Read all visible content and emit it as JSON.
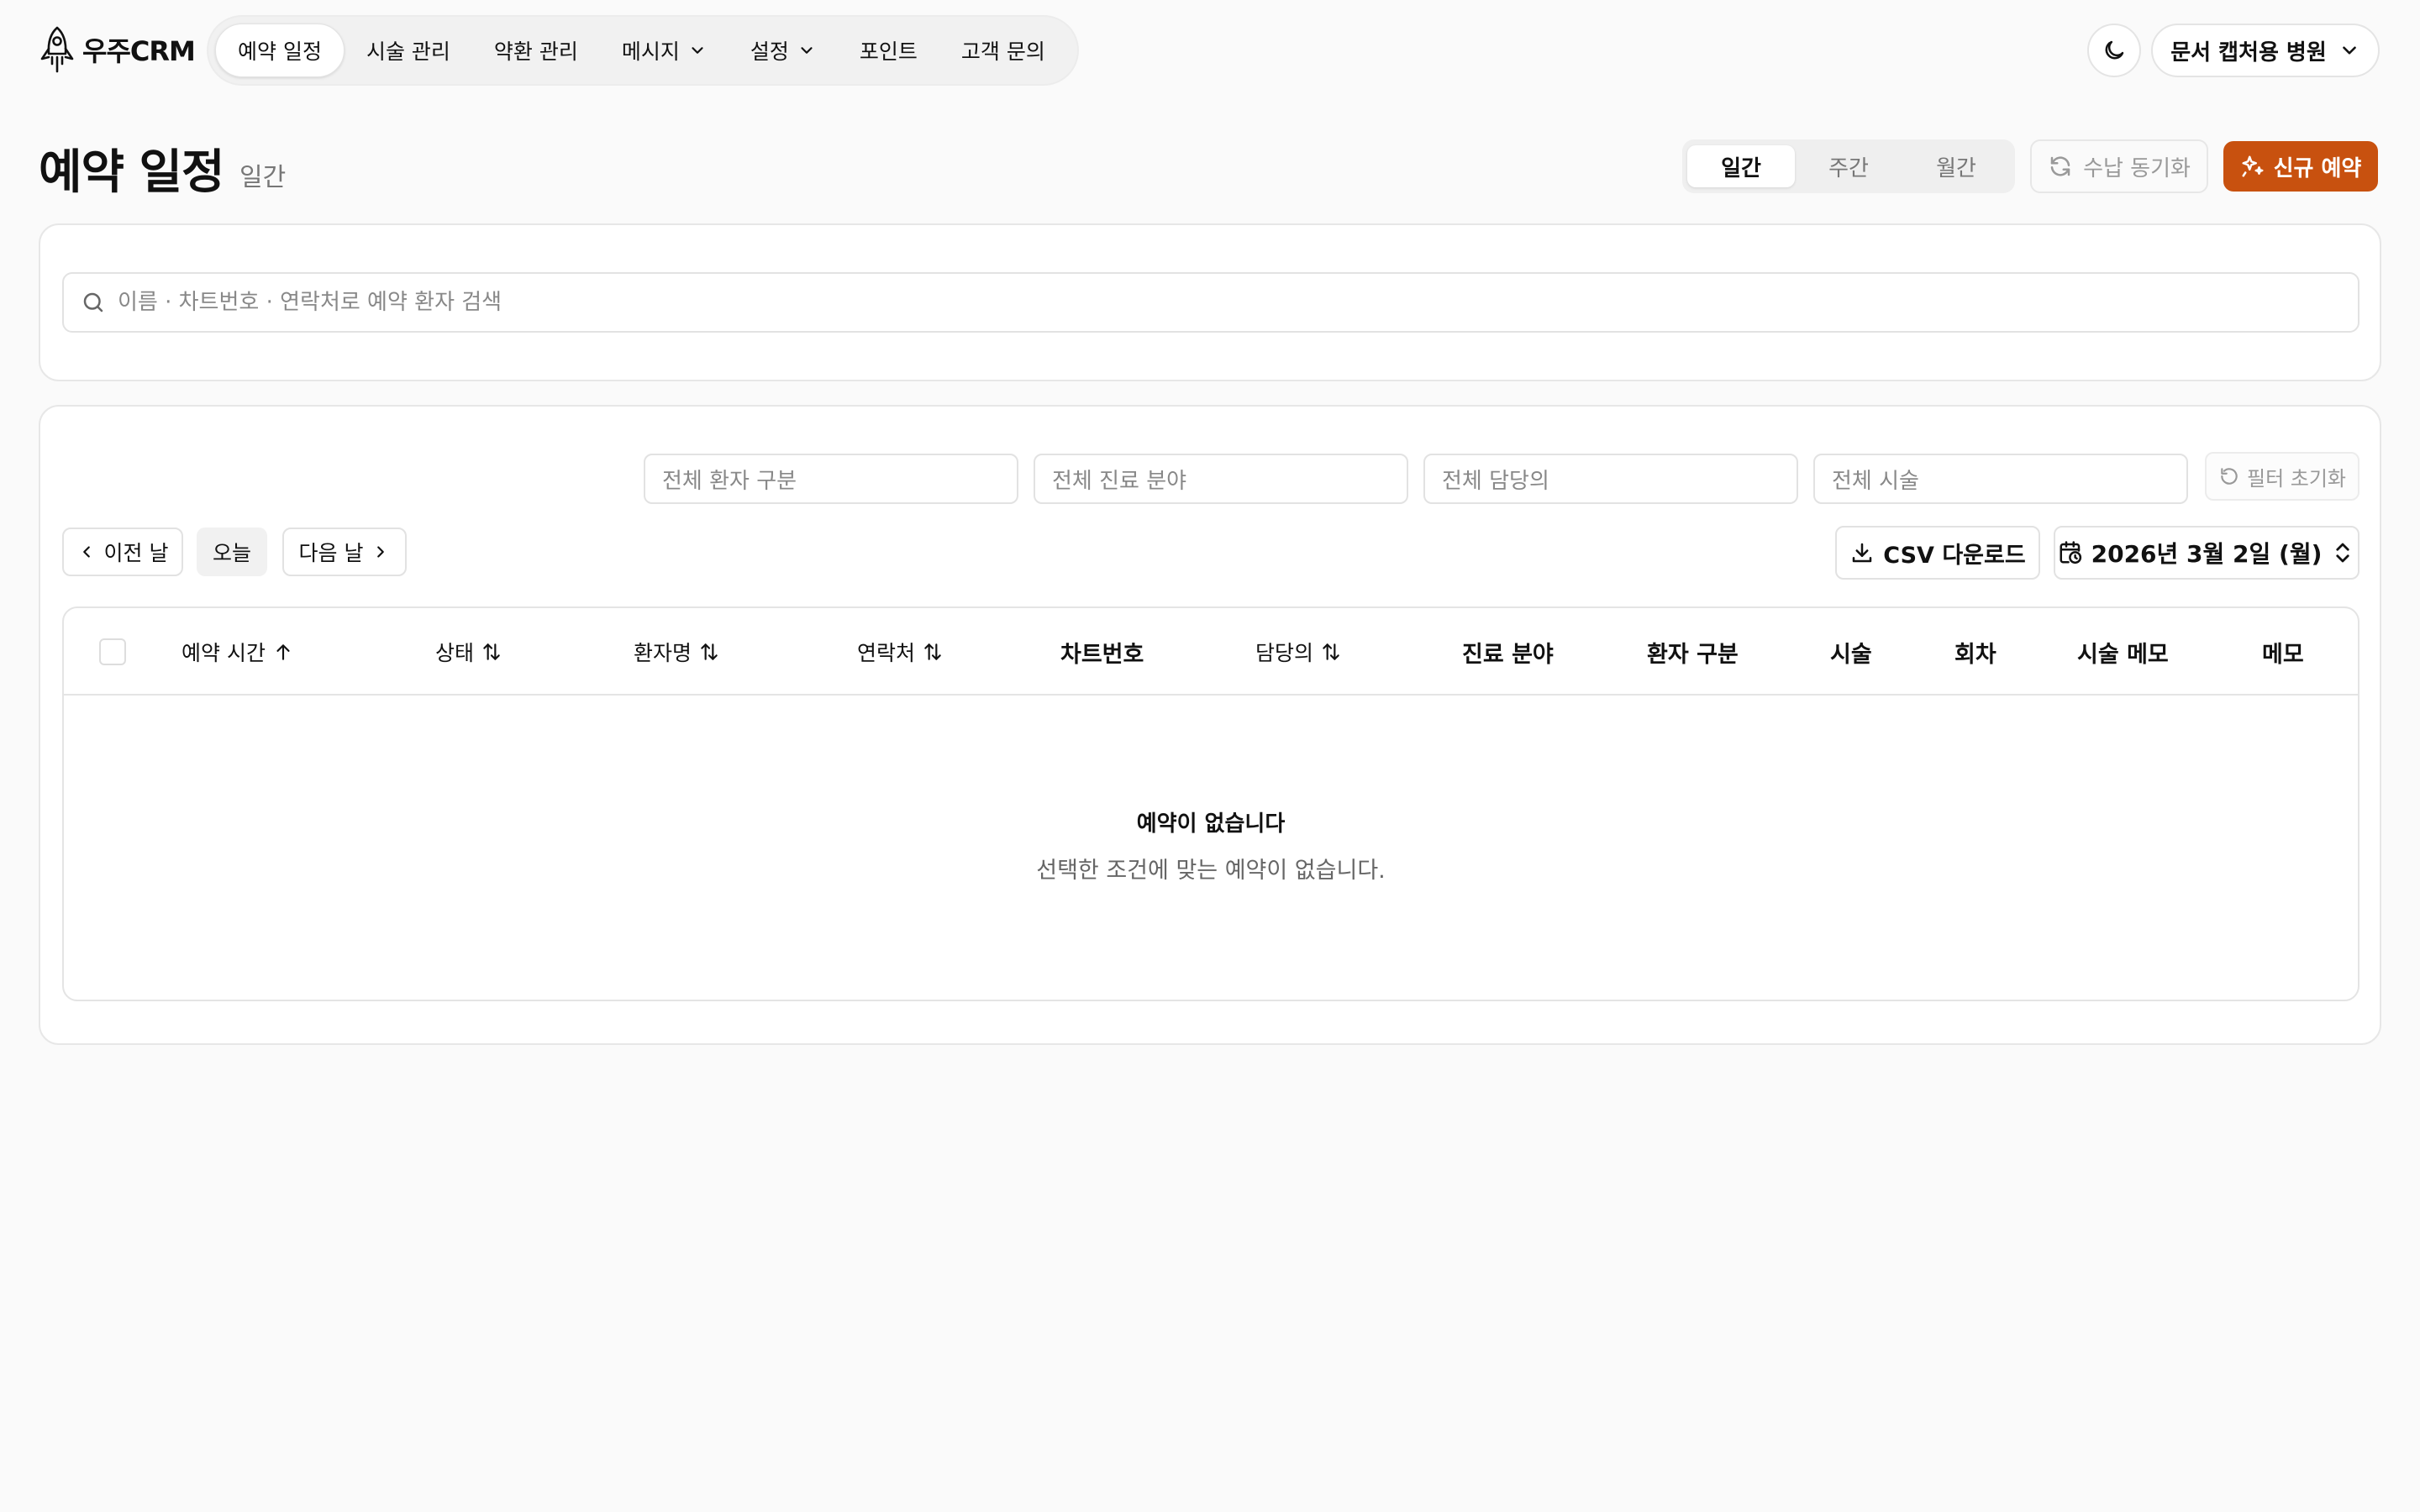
{
  "app": {
    "logo_text": "우주CRM"
  },
  "nav": {
    "items": [
      {
        "label": "예약 일정"
      },
      {
        "label": "시술 관리"
      },
      {
        "label": "약환 관리"
      },
      {
        "label": "메시지"
      },
      {
        "label": "설정"
      },
      {
        "label": "포인트"
      },
      {
        "label": "고객 문의"
      }
    ]
  },
  "header": {
    "clinic_label": "문서 캡처용 병원"
  },
  "page": {
    "title": "예약 일정",
    "subtitle": "일간",
    "view_tabs": [
      {
        "label": "일간"
      },
      {
        "label": "주간"
      },
      {
        "label": "월간"
      }
    ],
    "active_view": "일간",
    "sync_label": "수납 동기화",
    "new_label": "신규 예약"
  },
  "search": {
    "placeholder": "이름 · 차트번호 · 연락처로 예약 환자 검색"
  },
  "filters": {
    "patient_type": "전체 환자 구분",
    "department": "전체 진료 분야",
    "doctor": "전체 담당의",
    "procedure": "전체 시술",
    "reset_label": "필터 초기화"
  },
  "date_nav": {
    "prev_label": "이전 날",
    "today_label": "오늘",
    "next_label": "다음 날",
    "csv_label": "CSV 다운로드",
    "date_label": "2026년 3월 2일 (월)"
  },
  "table": {
    "columns": [
      {
        "label": "예약 시간"
      },
      {
        "label": "상태"
      },
      {
        "label": "환자명"
      },
      {
        "label": "연락처"
      },
      {
        "label": "차트번호"
      },
      {
        "label": "담당의"
      },
      {
        "label": "진료 분야"
      },
      {
        "label": "환자 구분"
      },
      {
        "label": "시술"
      },
      {
        "label": "회차"
      },
      {
        "label": "시술 메모"
      },
      {
        "label": "메모"
      }
    ],
    "empty_title": "예약이 없습니다",
    "empty_desc": "선택한 조건에 맞는 예약이 없습니다."
  },
  "colors": {
    "accent": "#c8510f",
    "border": "#e4e4e4",
    "background": "#fafafa"
  }
}
